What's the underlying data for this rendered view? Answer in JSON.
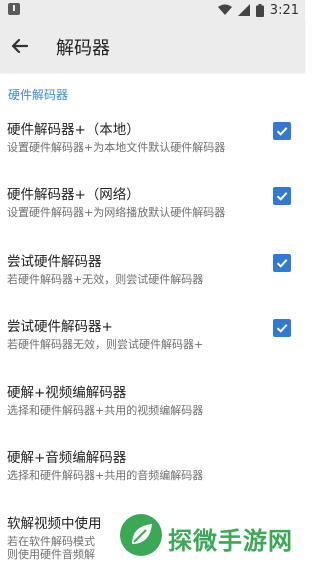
{
  "status_bar": {
    "time": "3:21"
  },
  "toolbar": {
    "title": "解码器"
  },
  "section": {
    "header": "硬件解码器"
  },
  "preferences": [
    {
      "title": "硬件解码器+（本地）",
      "summary": "设置硬件解码器+为本地文件默认硬件解码器",
      "checked": true
    },
    {
      "title": "硬件解码器+（网络）",
      "summary": "设置硬件解码器+为网络播放默认硬件解码器",
      "checked": true
    },
    {
      "title": "尝试硬件解码器",
      "summary": "若硬件解码器+无效，则尝试硬件解码器",
      "checked": true
    },
    {
      "title": "尝试硬件解码器+",
      "summary": "若硬件解码器无效，则尝试硬件解码器+",
      "checked": true
    },
    {
      "title": "硬解+视频编解码器",
      "summary": "选择和硬件解码器+共用的视频编解码器"
    },
    {
      "title": "硬解+音频编解码器",
      "summary": "选择和硬件解码器+共用的音频编解码器"
    },
    {
      "title": "软解视频中使用",
      "summary": "若在软件解码模式",
      "summary2": "则使用硬件音频解"
    }
  ],
  "watermark": {
    "text": "探微手游网"
  },
  "colors": {
    "accent": "#3279d4",
    "section": "#3a8ad8",
    "watermark": "#3aa855"
  }
}
